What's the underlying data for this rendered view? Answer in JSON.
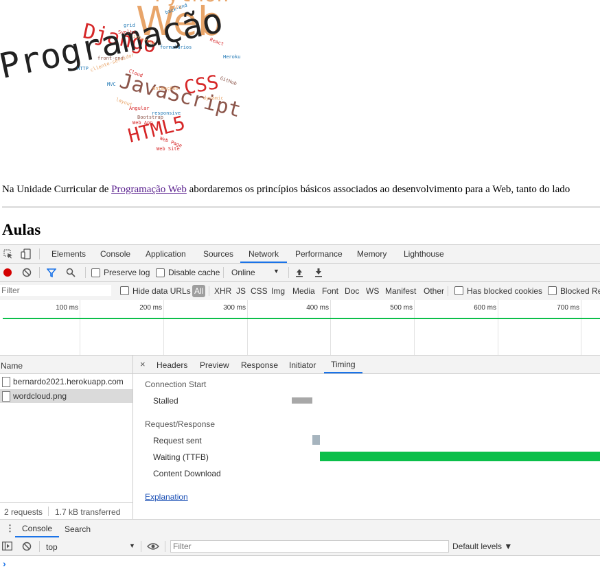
{
  "page": {
    "wordcloud": {
      "words": [
        {
          "text": "Python",
          "color": "#e8a56a"
        },
        {
          "text": "Web",
          "color": "#e8a56a"
        },
        {
          "text": "Django",
          "color": "#d62728"
        },
        {
          "text": "Programação",
          "color": "#222222"
        },
        {
          "text": "CSS",
          "color": "#d62728"
        },
        {
          "text": "JavaScript",
          "color": "#8c564b"
        },
        {
          "text": "HTML5",
          "color": "#d62728"
        },
        {
          "text": "back-end",
          "color": "#1f77b4"
        },
        {
          "text": "API",
          "color": "#e8a56a"
        },
        {
          "text": "grid",
          "color": "#1f77b4"
        },
        {
          "text": "Svelte",
          "color": "#d62728"
        },
        {
          "text": "internet",
          "color": "#e8a56a"
        },
        {
          "text": "formulários",
          "color": "#1f77b4"
        },
        {
          "text": "React",
          "color": "#d62728"
        },
        {
          "text": "Heroku",
          "color": "#1f77b4"
        },
        {
          "text": "front-end",
          "color": "#8c564b"
        },
        {
          "text": "cliente-servidor",
          "color": "#e8a56a"
        },
        {
          "text": "HTTP",
          "color": "#1f77b4"
        },
        {
          "text": "Cloud",
          "color": "#d62728"
        },
        {
          "text": "GitHub",
          "color": "#8c564b"
        },
        {
          "text": "MVC",
          "color": "#1f77b4"
        },
        {
          "text": "animações",
          "color": "#e8a56a"
        },
        {
          "text": "dynamic",
          "color": "#e8a56a"
        },
        {
          "text": "layout",
          "color": "#e8a56a"
        },
        {
          "text": "Angular",
          "color": "#d62728"
        },
        {
          "text": "responsive",
          "color": "#1f77b4"
        },
        {
          "text": "Bootstrap",
          "color": "#8c564b"
        },
        {
          "text": "Web App",
          "color": "#d62728"
        },
        {
          "text": "Web Page",
          "color": "#d62728"
        },
        {
          "text": "Web Site",
          "color": "#d62728"
        }
      ]
    },
    "intro": {
      "before": "Na Unidade Curricular de ",
      "link": "Programação Web",
      "after": " abordaremos os princípios básicos associados ao desenvolvimento para a Web, tanto do lado"
    },
    "heading": "Aulas"
  },
  "devtools": {
    "main_tabs": [
      "Elements",
      "Console",
      "Application",
      "Sources",
      "Network",
      "Performance",
      "Memory",
      "Lighthouse"
    ],
    "active_tab": "Network",
    "toolbar": {
      "preserve_log": "Preserve log",
      "disable_cache": "Disable cache",
      "throttling": "Online"
    },
    "filterbar": {
      "filter_placeholder": "Filter",
      "hide_data_urls": "Hide data URLs",
      "all": "All",
      "types": [
        "XHR",
        "JS",
        "CSS",
        "Img",
        "Media",
        "Font",
        "Doc",
        "WS",
        "Manifest",
        "Other"
      ],
      "has_blocked_cookies": "Has blocked cookies",
      "blocked_requests": "Blocked Re"
    },
    "overview": {
      "ticks": [
        "100 ms",
        "200 ms",
        "300 ms",
        "400 ms",
        "500 ms",
        "600 ms",
        "700 ms"
      ],
      "line_color": "#0bbf4a"
    },
    "requests": {
      "column_name": "Name",
      "items": [
        "bernardo2021.herokuapp.com",
        "wordcloud.png"
      ],
      "summary": [
        "2 requests",
        "1.7 kB transferred"
      ]
    },
    "detail": {
      "tabs": [
        "Headers",
        "Preview",
        "Response",
        "Initiator",
        "Timing"
      ],
      "active_tab": "Timing",
      "sections": [
        {
          "title": "Connection Start",
          "rows": [
            "Stalled"
          ]
        },
        {
          "title": "Request/Response",
          "rows": [
            "Request sent",
            "Waiting (TTFB)",
            "Content Download"
          ]
        }
      ],
      "explanation": "Explanation"
    },
    "drawer": {
      "tabs": [
        "Console",
        "Search"
      ],
      "context": "top",
      "filter_placeholder": "Filter",
      "levels": "Default levels ▼",
      "prompt": "›"
    },
    "colors": {
      "accent": "#1a73e8",
      "record": "#d40000",
      "ttfb": "#0bbf4a",
      "stalled": "#a8a8a8",
      "sent": "#a6b4be"
    }
  }
}
